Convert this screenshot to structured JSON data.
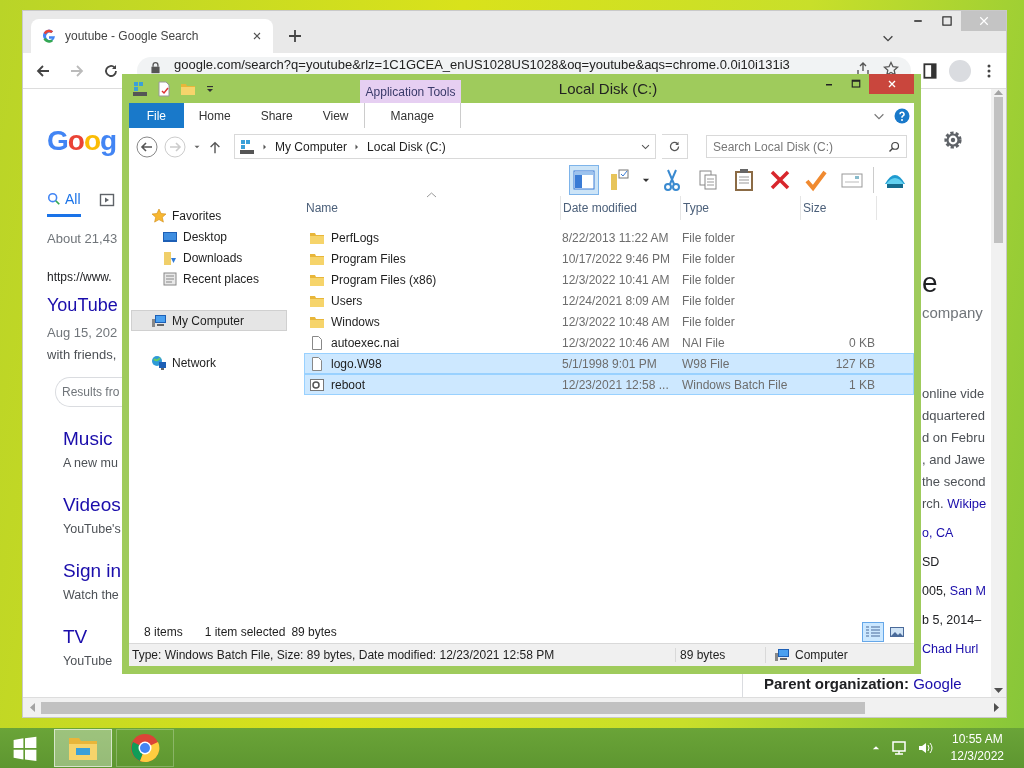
{
  "browser": {
    "tab_title": "youtube - Google Search",
    "url": "google.com/search?q=youtube&rlz=1C1GCEA_enUS1028US1028&oq=youtube&aqs=chrome.0.0i10i131i3",
    "page": {
      "logo": "Goog",
      "tabs": [
        {
          "label": "All",
          "selected": true
        }
      ],
      "result_stats": "About 21,43",
      "result": {
        "url": "https://www.",
        "title": "YouTube",
        "date": "Aug 15, 202",
        "snippet": "with friends,"
      },
      "chip": "Results fro",
      "sitelinks": [
        {
          "title": "Music",
          "text": "A new mu"
        },
        {
          "title": "Videos",
          "text": "YouTube's"
        },
        {
          "title": "Sign in",
          "text": "Watch the"
        },
        {
          "title": "TV",
          "text": "YouTube"
        }
      ],
      "knowledge_panel": {
        "title": "e",
        "subtitle": "company",
        "description": [
          {
            "text": "online vide"
          },
          {
            "text": "dquartered"
          },
          {
            "text": "d on Febru"
          },
          {
            "text": ", and Jawe"
          },
          {
            "text": "the second"
          },
          {
            "text": "rch. ",
            "link": "Wikipe"
          }
        ],
        "facts": [
          {
            "link": "o, CA"
          },
          {
            "text": "SD"
          },
          {
            "text": "005, ",
            "link": "San M"
          },
          {
            "text": "b 5, 2014–"
          },
          {
            "link": "Chad Hurl"
          }
        ],
        "parent": {
          "label": "Parent organization: ",
          "link": "Google"
        }
      }
    }
  },
  "explorer": {
    "title": "Local Disk (C:)",
    "contextual_group": "Application Tools",
    "ribbon_tabs": [
      {
        "label": "File",
        "kind": "file"
      },
      {
        "label": "Home",
        "kind": "plain"
      },
      {
        "label": "Share",
        "kind": "plain"
      },
      {
        "label": "View",
        "kind": "plain"
      },
      {
        "label": "Manage",
        "kind": "contextual"
      }
    ],
    "breadcrumb": [
      "My Computer",
      "Local Disk (C:)"
    ],
    "search": {
      "placeholder": "Search Local Disk (C:)"
    },
    "toolbar": [
      {
        "kind": "layout",
        "selected": true
      },
      {
        "kind": "folder-options",
        "selected": false
      },
      {
        "kind": "cut",
        "selected": false
      },
      {
        "kind": "copy",
        "selected": false
      },
      {
        "kind": "paste",
        "selected": false
      },
      {
        "kind": "delete",
        "selected": false
      },
      {
        "kind": "check",
        "selected": false
      },
      {
        "kind": "rename",
        "selected": false
      },
      {
        "kind": "shell",
        "selected": false
      }
    ],
    "navigation": [
      {
        "label": "Favorites",
        "kind": "star",
        "selected": false,
        "children": [
          {
            "label": "Desktop",
            "kind": "desktop",
            "selected": false
          },
          {
            "label": "Downloads",
            "kind": "downloads",
            "selected": false
          },
          {
            "label": "Recent places",
            "kind": "recent",
            "selected": false
          }
        ]
      },
      {
        "label": "My Computer",
        "kind": "computer",
        "selected": true
      },
      {
        "label": "Network",
        "kind": "network",
        "selected": false
      }
    ],
    "columns": [
      "Name",
      "Date modified",
      "Type",
      "Size"
    ],
    "files": [
      {
        "name": "PerfLogs",
        "date": "8/22/2013 11:22 AM",
        "type": "File folder",
        "kind": "folder",
        "selected": false
      },
      {
        "name": "Program Files",
        "date": "10/17/2022 9:46 PM",
        "type": "File folder",
        "kind": "folder",
        "selected": false
      },
      {
        "name": "Program Files (x86)",
        "date": "12/3/2022 10:41 AM",
        "type": "File folder",
        "kind": "folder",
        "selected": false
      },
      {
        "name": "Users",
        "date": "12/24/2021 8:09 AM",
        "type": "File folder",
        "kind": "folder",
        "selected": false
      },
      {
        "name": "Windows",
        "date": "12/3/2022 10:48 AM",
        "type": "File folder",
        "kind": "folder",
        "selected": false
      },
      {
        "name": "autoexec.nai",
        "date": "12/3/2022 10:46 AM",
        "type": "NAI File",
        "size": "0 KB",
        "kind": "file",
        "selected": false
      },
      {
        "name": "logo.W98",
        "date": "5/1/1998 9:01 PM",
        "type": "W98 File",
        "size": "127 KB",
        "kind": "file",
        "selected": true
      },
      {
        "name": "reboot",
        "date": "12/23/2021 12:58 ...",
        "type": "Windows Batch File",
        "size": "1 KB",
        "kind": "batch",
        "selected": true
      }
    ],
    "item_count": "8 items",
    "selection": "1 item selected",
    "selection_size": "89 bytes",
    "view_modes": [
      {
        "kind": "details",
        "selected": true
      },
      {
        "kind": "thumbnails",
        "selected": false
      }
    ],
    "status": {
      "details": "Type: Windows Batch File, Size: 89 bytes, Date modified: 12/23/2021 12:58 PM",
      "size": "89 bytes",
      "location": "Computer"
    }
  },
  "taskbar": {
    "apps": [
      {
        "kind": "explorer",
        "selected": true
      },
      {
        "kind": "chrome",
        "selected": false
      }
    ],
    "time": "10:55 AM",
    "date": "12/3/2022"
  }
}
